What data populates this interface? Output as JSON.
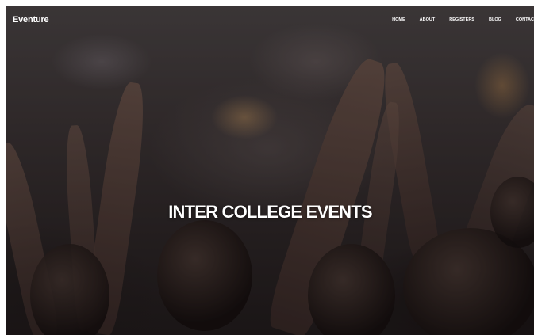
{
  "brand": {
    "name": "Eventure"
  },
  "nav": {
    "items": [
      {
        "label": "HOME"
      },
      {
        "label": "ABOUT"
      },
      {
        "label": "REGISTERS"
      },
      {
        "label": "BLOG"
      },
      {
        "label": "CONTAC"
      }
    ]
  },
  "hero": {
    "title": "INTER COLLEGE EVENTS",
    "background_image": "concert-crowd-raised-hands"
  },
  "colors": {
    "text": "#ffffff",
    "background": "#2a2626"
  }
}
